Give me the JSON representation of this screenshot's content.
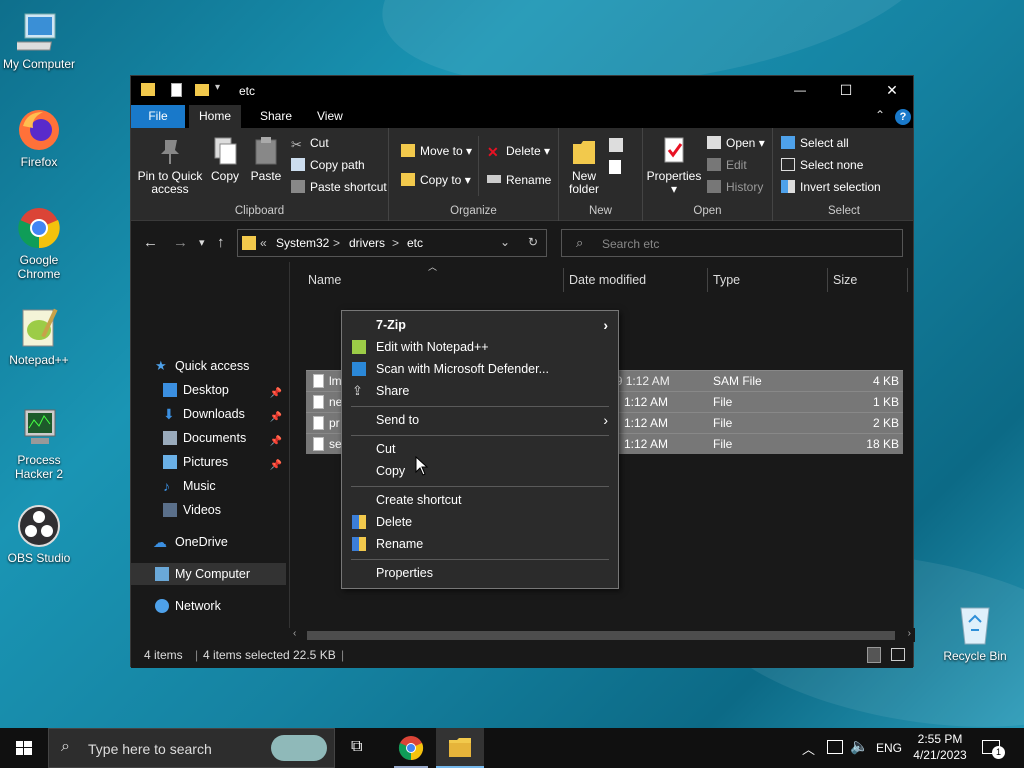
{
  "desktop": {
    "icons": [
      {
        "label": "My Computer"
      },
      {
        "label": "Firefox"
      },
      {
        "label": "Google Chrome"
      },
      {
        "label": "Notepad++"
      },
      {
        "label": "Process Hacker 2"
      },
      {
        "label": "OBS Studio"
      },
      {
        "label": "Recycle Bin"
      }
    ]
  },
  "window": {
    "title": "etc",
    "controls": {
      "minimize": "—",
      "maximize": "☐",
      "close": "✕"
    },
    "tabs": [
      "File",
      "Home",
      "Share",
      "View"
    ]
  },
  "ribbon": {
    "clipboard": {
      "label": "Clipboard",
      "pin": "Pin to Quick access",
      "copy": "Copy",
      "paste": "Paste",
      "cut": "Cut",
      "copy_path": "Copy path",
      "paste_shortcut": "Paste shortcut"
    },
    "organize": {
      "label": "Organize",
      "move_to": "Move to",
      "copy_to": "Copy to",
      "delete": "Delete",
      "rename": "Rename"
    },
    "new": {
      "label": "New",
      "new_folder": "New folder"
    },
    "open": {
      "label": "Open",
      "properties": "Properties",
      "open": "Open",
      "edit": "Edit",
      "history": "History"
    },
    "select": {
      "label": "Select",
      "select_all": "Select all",
      "select_none": "Select none",
      "invert": "Invert selection"
    }
  },
  "address": {
    "crumbs": [
      "«",
      "System32",
      ">",
      "drivers",
      ">",
      "etc"
    ],
    "search_placeholder": "Search etc"
  },
  "navpane": {
    "items": [
      {
        "label": "Quick access",
        "pinned": false
      },
      {
        "label": "Desktop",
        "pinned": true
      },
      {
        "label": "Downloads",
        "pinned": true
      },
      {
        "label": "Documents",
        "pinned": true
      },
      {
        "label": "Pictures",
        "pinned": true
      },
      {
        "label": "Music",
        "pinned": false
      },
      {
        "label": "Videos",
        "pinned": false
      },
      {
        "label": "OneDrive",
        "pinned": false
      },
      {
        "label": "My Computer",
        "pinned": false
      },
      {
        "label": "Network",
        "pinned": false
      }
    ]
  },
  "filelist": {
    "columns": [
      "Name",
      "Date modified",
      "Type",
      "Size"
    ],
    "rows": [
      {
        "name": "lmhosts.sam",
        "date": "12/7/2019 1:12 AM",
        "type": "SAM File",
        "size": "4 KB"
      },
      {
        "name": "ne",
        "date": "1:12 AM",
        "type": "File",
        "size": "1 KB"
      },
      {
        "name": "pr",
        "date": "1:12 AM",
        "type": "File",
        "size": "2 KB"
      },
      {
        "name": "se",
        "date": "1:12 AM",
        "type": "File",
        "size": "18 KB"
      }
    ]
  },
  "status": {
    "count": "4 items",
    "selected": "4 items selected",
    "size": "22.5 KB"
  },
  "context_menu": {
    "items": [
      {
        "label": "7-Zip",
        "submenu": true
      },
      {
        "label": "Edit with Notepad++"
      },
      {
        "label": "Scan with Microsoft Defender..."
      },
      {
        "label": "Share"
      },
      {
        "label": "Send to",
        "submenu": true
      },
      {
        "label": "Cut"
      },
      {
        "label": "Copy"
      },
      {
        "label": "Create shortcut"
      },
      {
        "label": "Delete"
      },
      {
        "label": "Rename"
      },
      {
        "label": "Properties"
      }
    ]
  },
  "taskbar": {
    "search_placeholder": "Type here to search",
    "language": "ENG",
    "time": "2:55 PM",
    "date": "4/21/2023",
    "notification_count": "1"
  },
  "colors": {
    "accent": "#1979ca",
    "selection": "#777777",
    "window_bg": "#191919"
  }
}
